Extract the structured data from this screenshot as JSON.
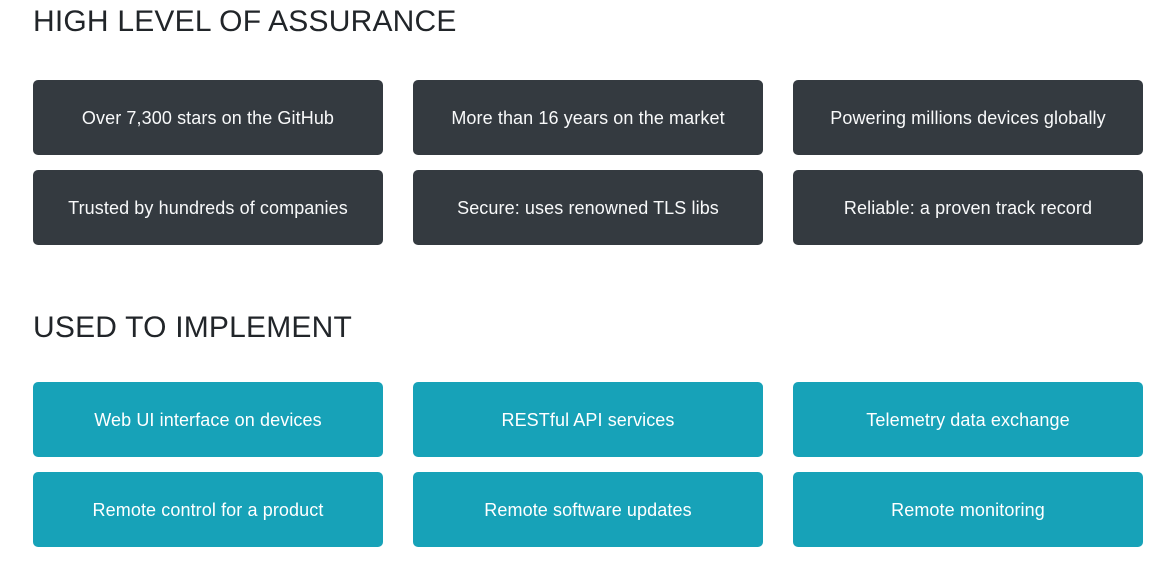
{
  "theme": {
    "background": "#ffffff",
    "heading_color": "#212529",
    "dark_card_bg": "#343a40",
    "dark_card_text": "#f8f9fa",
    "teal_card_bg": "#17a2b8",
    "teal_card_text": "#ffffff"
  },
  "sections": {
    "assurance": {
      "heading": "HIGH LEVEL OF ASSURANCE",
      "cards": [
        {
          "label": "Over 7,300 stars on the GitHub"
        },
        {
          "label": "More than 16 years on the market"
        },
        {
          "label": "Powering millions devices globally"
        },
        {
          "label": "Trusted by hundreds of companies"
        },
        {
          "label": "Secure: uses renowned TLS libs"
        },
        {
          "label": "Reliable: a proven track record"
        }
      ]
    },
    "implement": {
      "heading": "USED TO IMPLEMENT",
      "cards": [
        {
          "label": "Web UI interface on devices"
        },
        {
          "label": "RESTful API services"
        },
        {
          "label": "Telemetry data exchange"
        },
        {
          "label": "Remote control for a product"
        },
        {
          "label": "Remote software updates"
        },
        {
          "label": "Remote monitoring"
        }
      ]
    }
  }
}
